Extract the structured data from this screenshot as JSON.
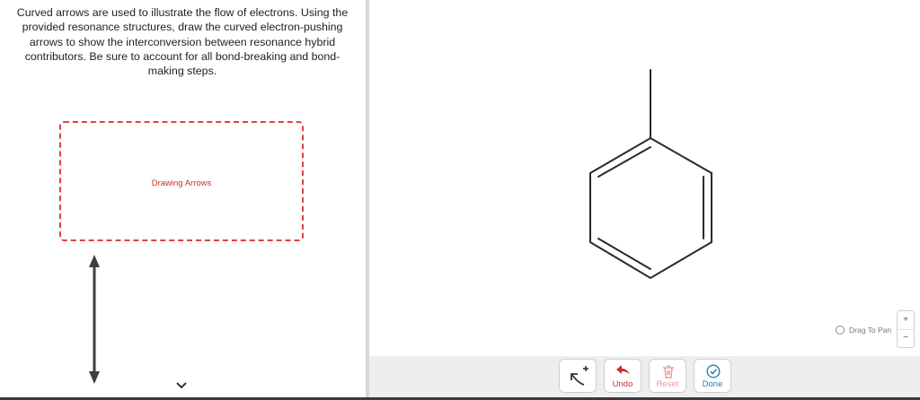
{
  "instructions": "Curved arrows are used to illustrate the flow of electrons. Using the provided resonance structures, draw the curved electron-pushing arrows to show the interconversion between resonance hybrid contributors. Be sure to account for all bond-breaking and bond-making steps.",
  "drop_zone": {
    "label": "Drawing Arrows"
  },
  "toolbar": {
    "arrow_tool_icon": "curved-arrow-plus-icon",
    "undo_label": "Undo",
    "reset_label": "Reset",
    "done_label": "Done"
  },
  "pan": {
    "label": "Drag To Pan"
  },
  "zoom": {
    "in": "+",
    "out": "−"
  },
  "colors": {
    "accent_red": "#c9302c",
    "done_teal": "#2b7fa8",
    "divider": "#d7d7d7"
  }
}
